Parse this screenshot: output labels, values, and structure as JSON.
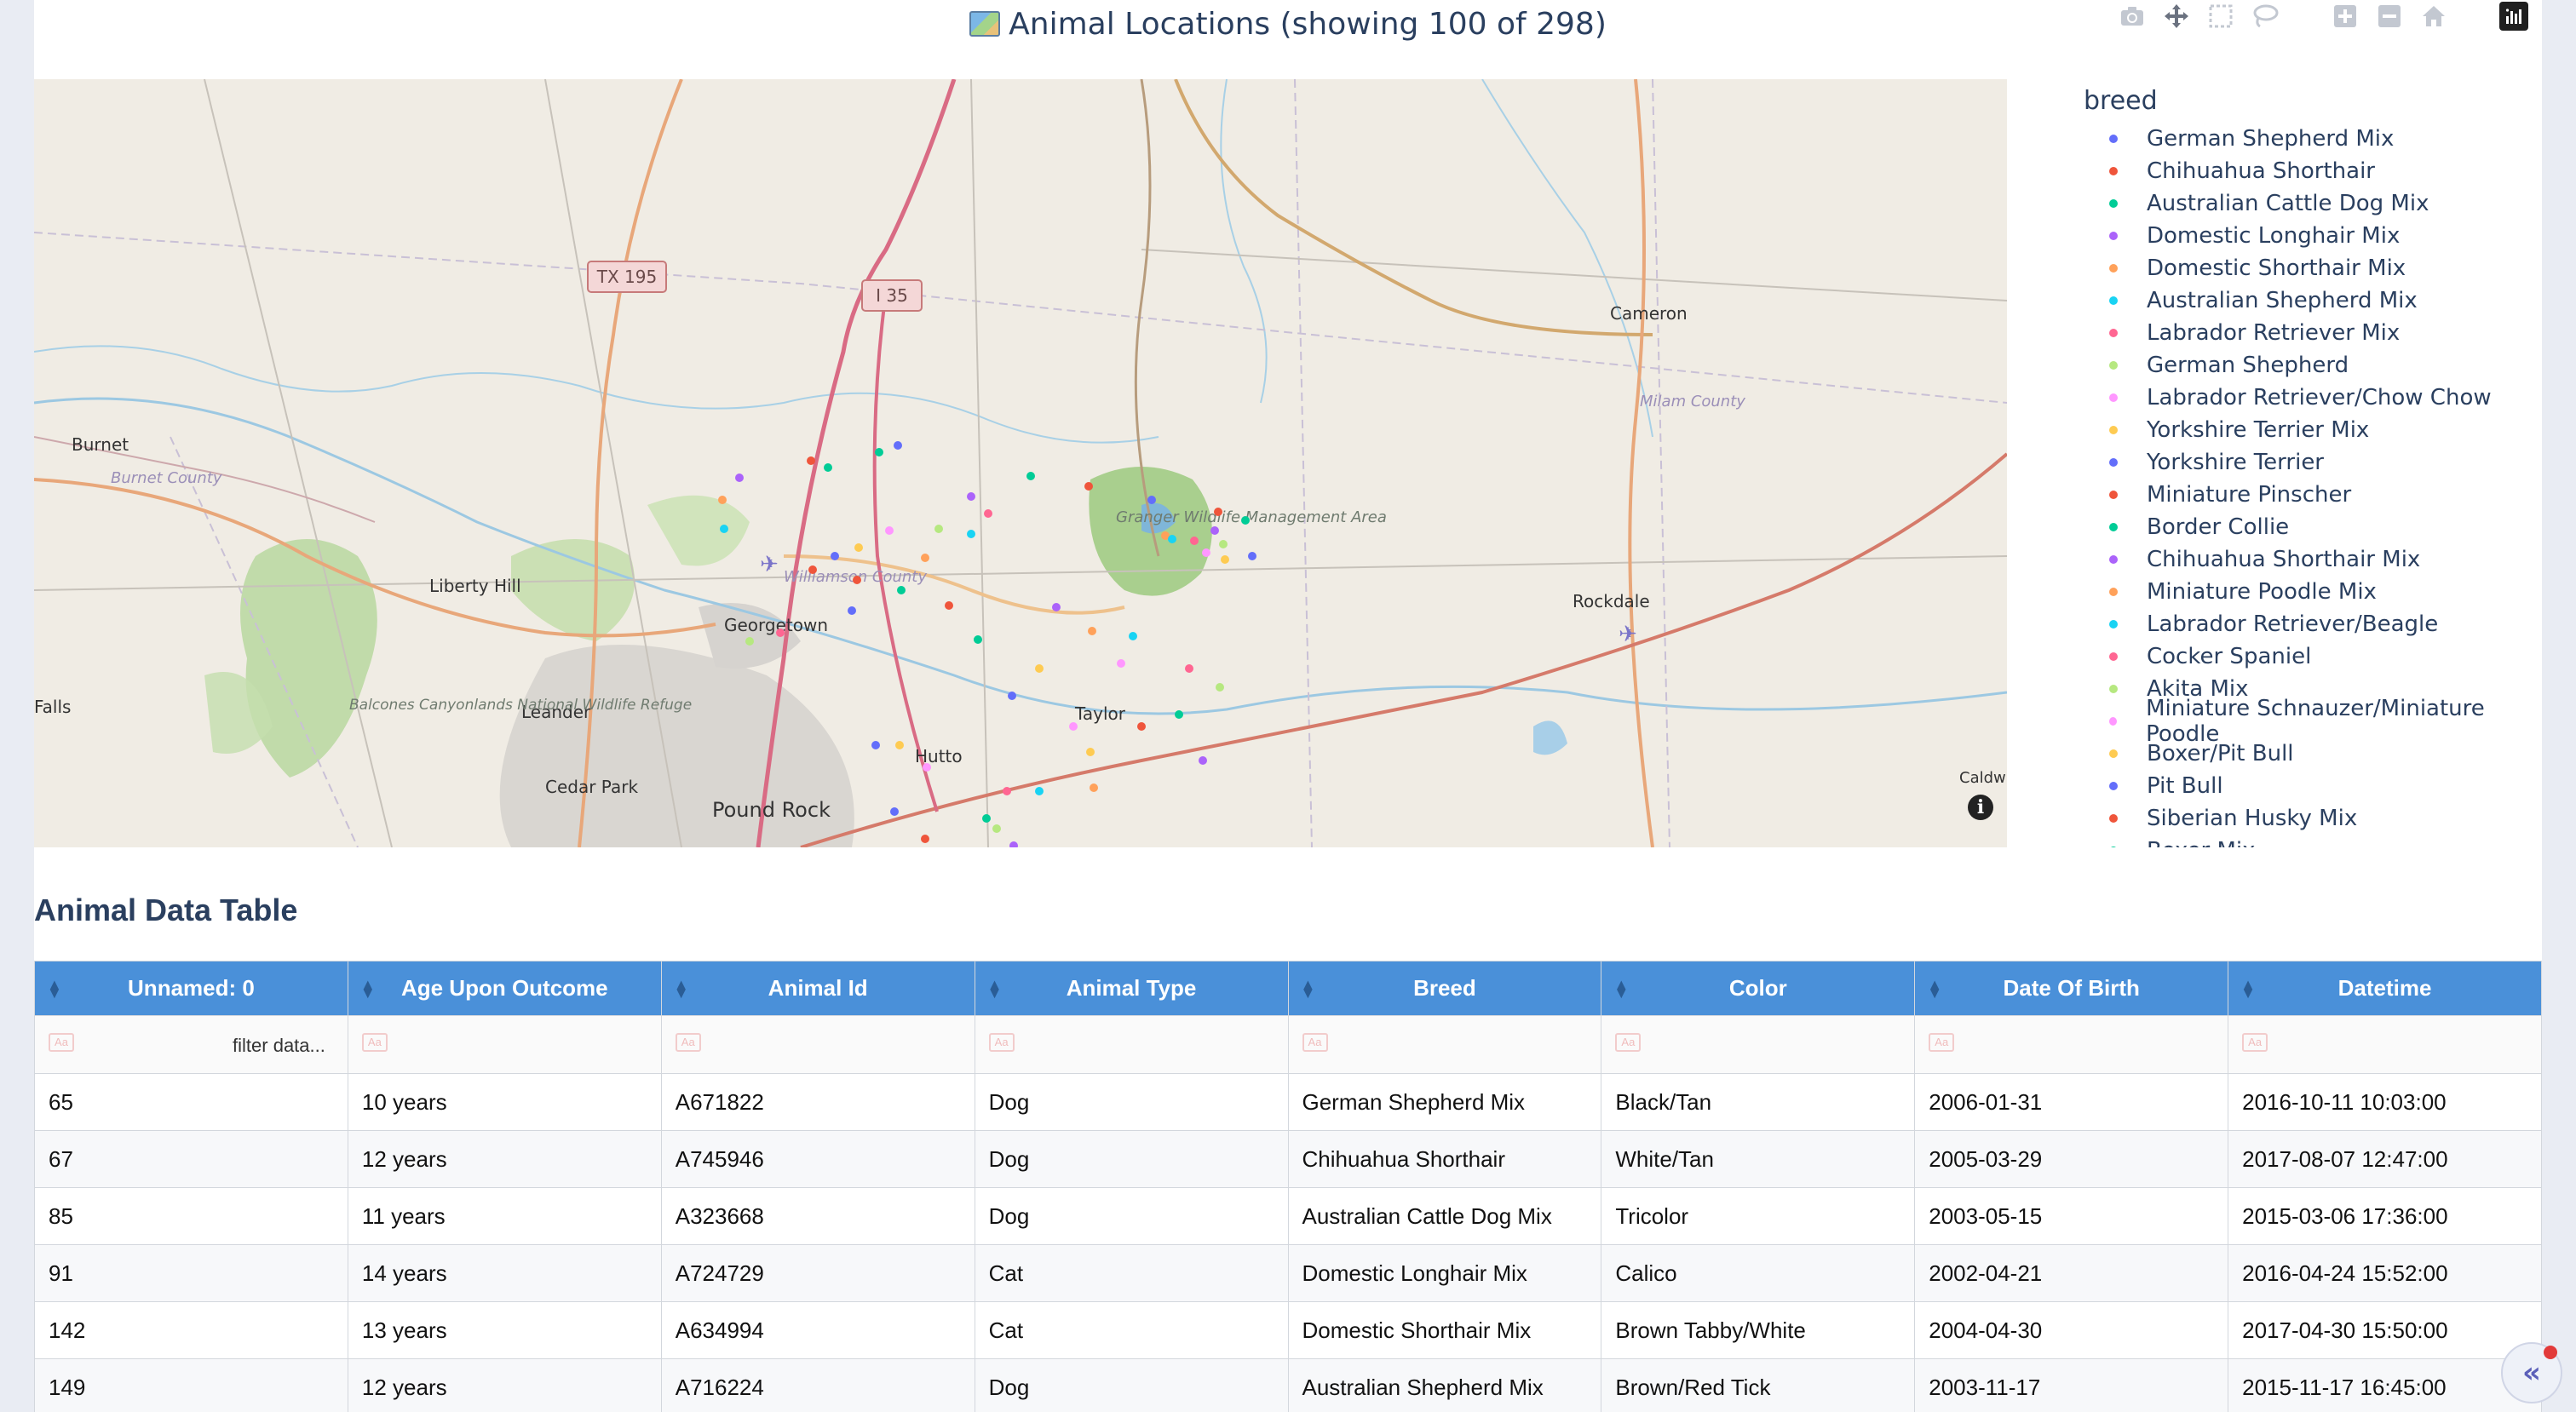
{
  "figure": {
    "title": "Animal Locations (showing 100 of 298)",
    "modebar": [
      "camera-icon",
      "pan-icon",
      "box-select-icon",
      "lasso-icon",
      "zoom-in-icon",
      "zoom-out-icon",
      "reset-home-icon",
      "plotly-logo-icon"
    ]
  },
  "map": {
    "places": [
      {
        "label": "TX 195",
        "kind": "shield"
      },
      {
        "label": "I 35",
        "kind": "shield"
      },
      {
        "label": "Cameron",
        "kind": "town"
      },
      {
        "label": "Milam County",
        "kind": "county"
      },
      {
        "label": "Burnet",
        "kind": "town"
      },
      {
        "label": "Burnet County",
        "kind": "county"
      },
      {
        "label": "Liberty Hill",
        "kind": "town"
      },
      {
        "label": "Williamson County",
        "kind": "county"
      },
      {
        "label": "Granger Wildlife Management Area",
        "kind": "park"
      },
      {
        "label": "Georgetown",
        "kind": "town"
      },
      {
        "label": "Rockdale",
        "kind": "town"
      },
      {
        "label": "Falls",
        "kind": "town"
      },
      {
        "label": "Leander",
        "kind": "town"
      },
      {
        "label": "Balcones Canyonlands National Wildlife Refuge",
        "kind": "park"
      },
      {
        "label": "Taylor",
        "kind": "town"
      },
      {
        "label": "Hutto",
        "kind": "town"
      },
      {
        "label": "Cedar Park",
        "kind": "town"
      },
      {
        "label": "Pound Rock",
        "kind": "town"
      },
      {
        "label": "Caldw",
        "kind": "town"
      }
    ]
  },
  "legend": {
    "title": "breed",
    "items": [
      {
        "label": "German Shepherd Mix",
        "color": "#636efa"
      },
      {
        "label": "Chihuahua Shorthair",
        "color": "#ef553b"
      },
      {
        "label": "Australian Cattle Dog Mix",
        "color": "#00cc96"
      },
      {
        "label": "Domestic Longhair Mix",
        "color": "#ab63fa"
      },
      {
        "label": "Domestic Shorthair Mix",
        "color": "#ffa15a"
      },
      {
        "label": "Australian Shepherd Mix",
        "color": "#19d3f3"
      },
      {
        "label": "Labrador Retriever Mix",
        "color": "#ff6692"
      },
      {
        "label": "German Shepherd",
        "color": "#b6e880"
      },
      {
        "label": "Labrador Retriever/Chow Chow",
        "color": "#ff97ff"
      },
      {
        "label": "Yorkshire Terrier Mix",
        "color": "#fecb52"
      },
      {
        "label": "Yorkshire Terrier",
        "color": "#636efa"
      },
      {
        "label": "Miniature Pinscher",
        "color": "#ef553b"
      },
      {
        "label": "Border Collie",
        "color": "#00cc96"
      },
      {
        "label": "Chihuahua Shorthair Mix",
        "color": "#ab63fa"
      },
      {
        "label": "Miniature Poodle Mix",
        "color": "#ffa15a"
      },
      {
        "label": "Labrador Retriever/Beagle",
        "color": "#19d3f3"
      },
      {
        "label": "Cocker Spaniel",
        "color": "#ff6692"
      },
      {
        "label": "Akita Mix",
        "color": "#b6e880"
      },
      {
        "label": "Miniature Schnauzer/Miniature Poodle",
        "color": "#ff97ff"
      },
      {
        "label": "Boxer/Pit Bull",
        "color": "#fecb52"
      },
      {
        "label": "Pit Bull",
        "color": "#636efa"
      },
      {
        "label": "Siberian Husky Mix",
        "color": "#ef553b"
      },
      {
        "label": "Boxer Mix",
        "color": "#00cc96"
      }
    ]
  },
  "table": {
    "title": "Animal Data Table",
    "filter_placeholder": "filter data...",
    "filter_icon_text": "Aa",
    "columns": [
      "Unnamed: 0",
      "Age Upon Outcome",
      "Animal Id",
      "Animal Type",
      "Breed",
      "Color",
      "Date Of Birth",
      "Datetime"
    ],
    "rows": [
      [
        "65",
        "10 years",
        "A671822",
        "Dog",
        "German Shepherd Mix",
        "Black/Tan",
        "2006-01-31",
        "2016-10-11 10:03:00"
      ],
      [
        "67",
        "12 years",
        "A745946",
        "Dog",
        "Chihuahua Shorthair",
        "White/Tan",
        "2005-03-29",
        "2017-08-07 12:47:00"
      ],
      [
        "85",
        "11 years",
        "A323668",
        "Dog",
        "Australian Cattle Dog Mix",
        "Tricolor",
        "2003-05-15",
        "2015-03-06 17:36:00"
      ],
      [
        "91",
        "14 years",
        "A724729",
        "Cat",
        "Domestic Longhair Mix",
        "Calico",
        "2002-04-21",
        "2016-04-24 15:52:00"
      ],
      [
        "142",
        "13 years",
        "A634994",
        "Cat",
        "Domestic Shorthair Mix",
        "Brown Tabby/White",
        "2004-04-30",
        "2017-04-30 15:50:00"
      ],
      [
        "149",
        "12 years",
        "A716224",
        "Dog",
        "Australian Shepherd Mix",
        "Brown/Red Tick",
        "2003-11-17",
        "2015-11-17 16:45:00"
      ]
    ]
  },
  "chat_button": {
    "icon": "chevrons-left-icon"
  }
}
